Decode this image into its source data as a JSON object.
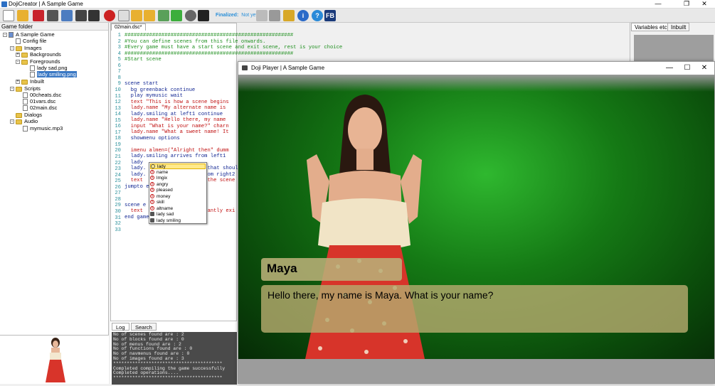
{
  "window": {
    "title": "DojiCreator | A Sample Game",
    "min": "—",
    "max": "❐",
    "close": "✕"
  },
  "toolbar": {
    "finalized_label": "Finalized:",
    "finalized_value": "Not yet",
    "fb_label": "FB",
    "info_label": "i",
    "help_label": "?"
  },
  "game_folder": {
    "header": "Game folder",
    "items": [
      "A Sample Game",
      "Config file",
      "Images",
      "Backgrounds",
      "Foregrounds",
      "lady sad.png",
      "lady smiling.png",
      "Inbuilt",
      "Scripts",
      "00cheats.dsc",
      "01vars.dsc",
      "02main.dsc",
      "Dialogs",
      "Audio",
      "mymusic.mp3"
    ]
  },
  "editor": {
    "tab": "02main.dsc*",
    "lines": [
      "1",
      "2",
      "3",
      "4",
      "5",
      "6",
      "7",
      "8",
      "9",
      "10",
      "11",
      "12",
      "13",
      "14",
      "15",
      "16",
      "17",
      "18",
      "19",
      "20",
      "21",
      "22",
      "23",
      "24",
      "25",
      "26",
      "27",
      "28",
      "29",
      "30",
      "31",
      "32",
      "33"
    ],
    "code": {
      "l1": "#######################################################",
      "l2": "#You can define scenes from this file onwards.",
      "l3": "#Every game must have a start scene and exit scene, rest is your choice",
      "l4": "#######################################################",
      "l5": "#Start scene",
      "l9": "scene start",
      "l10": "  bg greenback continue",
      "l11": "  play mymusic wait",
      "l12": "  text \"This is how a scene begins",
      "l13": "  lady.name \"My alternate name is",
      "l14": "  lady.smiling at left1 continue",
      "l15": "  lady.name \"Hello there, my name",
      "l16": "  input \"What is your name?\" charn",
      "l17": "  lady.name \"What a sweet name! It",
      "l18": "  showmenu options",
      "l20": "  imenu almen=(\"Alright then\" dumm",
      "l21": "  lady.smiling arrives from left1",
      "l22": "  lady",
      "l23": "  lady.                    that shoul",
      "l24": "  lady.                    om right2",
      "l25": "  text                     the scene",
      "l26": "jumpto e",
      "l29": "scene e",
      "l30": "  text                    eantly exi",
      "l31": "end game"
    }
  },
  "autocomplete": [
    "lady",
    "name",
    "lmgix",
    "angry",
    "pleased",
    "money",
    "skill",
    "altname",
    "lady sad",
    "lady smiling"
  ],
  "log": {
    "tabs": [
      "Log",
      "Search"
    ],
    "lines": [
      "No of scenes found are : 2",
      "No of blocks found are : 0",
      "No of menus found are : 2",
      "No of functions found are : 0",
      "No of navmenus found are : 0",
      "No of images found are : 3",
      "****************************************",
      "Completed compiling the game successfully",
      "Completed operations....",
      "****************************************"
    ]
  },
  "right_panel": {
    "tabs": [
      "Variables etc",
      "Inbuilt"
    ]
  },
  "player": {
    "title": "Doji Player | A Sample Game",
    "speaker": "Maya",
    "dialog": "Hello there, my name is Maya. What is your name?",
    "min": "—",
    "max": "☐",
    "close": "✕"
  },
  "colors": {
    "stage_green": "#157a15",
    "dialog_box": "#b4aa6e",
    "comment_green": "#1f8f1f",
    "keyword_navy": "#0a1f8f",
    "string_red": "#c01010"
  }
}
